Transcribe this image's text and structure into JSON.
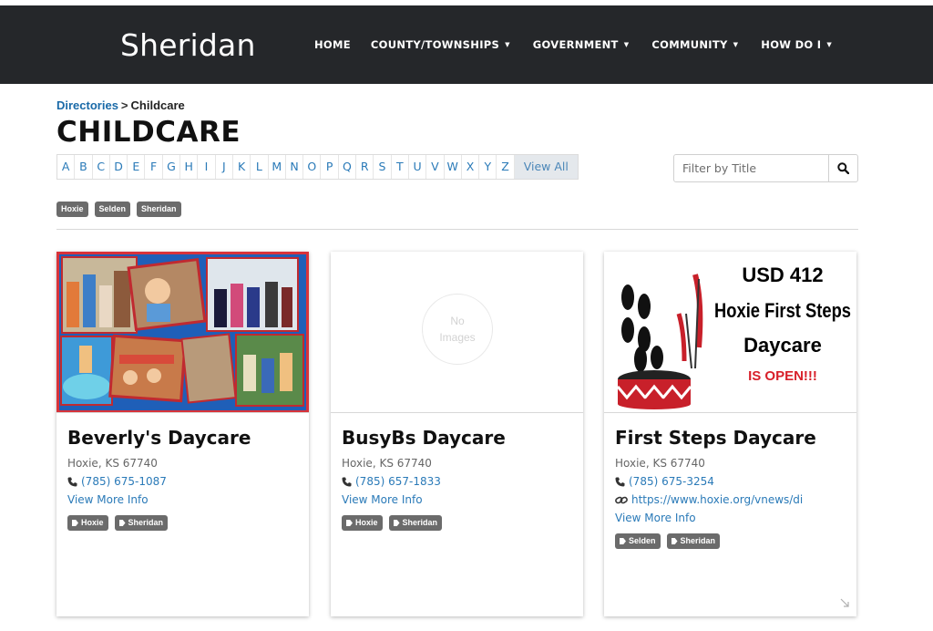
{
  "site": {
    "title": "Sheridan"
  },
  "nav": [
    {
      "label": "HOME",
      "dropdown": false
    },
    {
      "label": "COUNTY/TOWNSHIPS",
      "dropdown": true
    },
    {
      "label": "GOVERNMENT",
      "dropdown": true
    },
    {
      "label": "COMMUNITY",
      "dropdown": true
    },
    {
      "label": "HOW DO I",
      "dropdown": true
    }
  ],
  "breadcrumb": {
    "parent": "Directories",
    "separator": ">",
    "current": "Childcare"
  },
  "page": {
    "title": "CHILDCARE"
  },
  "alphabet": [
    "A",
    "B",
    "C",
    "D",
    "E",
    "F",
    "G",
    "H",
    "I",
    "J",
    "K",
    "L",
    "M",
    "N",
    "O",
    "P",
    "Q",
    "R",
    "S",
    "T",
    "U",
    "V",
    "W",
    "X",
    "Y",
    "Z"
  ],
  "alphabet_view_all": "View All",
  "filter": {
    "placeholder": "Filter by Title",
    "icon": "search-icon"
  },
  "filter_tags": [
    "Hoxie",
    "Selden",
    "Sheridan"
  ],
  "cards": [
    {
      "name": "Beverly's Daycare",
      "address": "Hoxie, KS 67740",
      "phone": "(785) 675-1087",
      "more": "View More Info",
      "tags": [
        "Hoxie",
        "Sheridan"
      ],
      "image": "photo-collage"
    },
    {
      "name": "BusyBs Daycare",
      "address": "Hoxie, KS 67740",
      "phone": "(785) 657-1833",
      "more": "View More Info",
      "tags": [
        "Hoxie",
        "Sheridan"
      ],
      "no_image_line1": "No",
      "no_image_line2": "Images"
    },
    {
      "name": "First Steps Daycare",
      "address": "Hoxie, KS 67740",
      "phone": "(785) 675-3254",
      "website": "https://www.hoxie.org/vnews/di",
      "more": "View More Info",
      "tags": [
        "Selden",
        "Sheridan"
      ],
      "image_text": {
        "line1": "USD 412",
        "line2": "Hoxie First Steps",
        "line3": "Daycare",
        "line4": "IS OPEN!!!"
      }
    }
  ],
  "colors": {
    "header_bg": "#25272a",
    "link": "#2a7ab8",
    "tag_bg": "#6b6b6b",
    "collage_border": "#d8333a",
    "collage_bg": "#1f5fb8"
  }
}
